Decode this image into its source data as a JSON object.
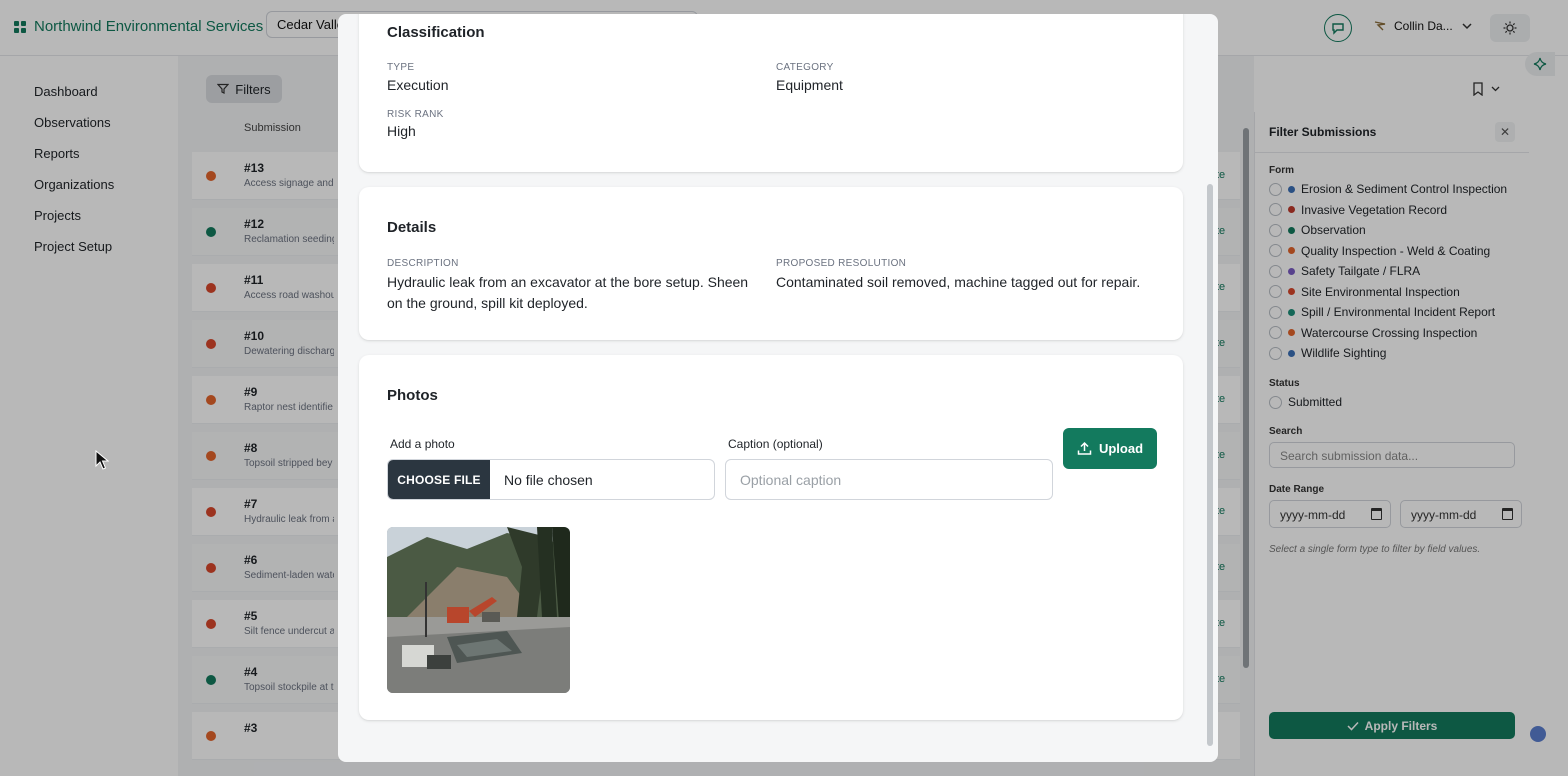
{
  "app": {
    "brand": "Northwind Environmental Services",
    "project_select": "Cedar Valle",
    "user_name": "Collin Da..."
  },
  "sidebar": {
    "items": [
      {
        "label": "Dashboard"
      },
      {
        "label": "Observations"
      },
      {
        "label": "Reports"
      },
      {
        "label": "Organizations"
      },
      {
        "label": "Projects"
      },
      {
        "label": "Project Setup"
      }
    ]
  },
  "list": {
    "filters_label": "Filters",
    "column_header": "Submission",
    "rows": [
      {
        "num": "#13",
        "desc": "Access signage and c",
        "color": "#e4642b",
        "trail": "te"
      },
      {
        "num": "#12",
        "desc": "Reclamation seeding",
        "color": "#137a5e",
        "trail": "te"
      },
      {
        "num": "#11",
        "desc": "Access road washout",
        "color": "#d9472b",
        "trail": "te"
      },
      {
        "num": "#10",
        "desc": "Dewatering discharg",
        "color": "#d9472b",
        "trail": "te"
      },
      {
        "num": "#9",
        "desc": "Raptor nest identifie",
        "color": "#e4642b",
        "trail": "te"
      },
      {
        "num": "#8",
        "desc": "Topsoil stripped bey",
        "color": "#e4642b",
        "trail": "te"
      },
      {
        "num": "#7",
        "desc": "Hydraulic leak from a",
        "color": "#d9472b",
        "trail": "te"
      },
      {
        "num": "#6",
        "desc": "Sediment-laden wate",
        "color": "#d9472b",
        "trail": "te"
      },
      {
        "num": "#5",
        "desc": "Silt fence undercut a",
        "color": "#d9472b",
        "trail": "te"
      },
      {
        "num": "#4",
        "desc": "Topsoil stockpile at t",
        "color": "#137a5e",
        "trail": "te"
      },
      {
        "num": "#3",
        "desc": "",
        "color": "#e4642b",
        "trail": ""
      }
    ]
  },
  "filter_panel": {
    "title": "Filter Submissions",
    "form_label": "Form",
    "forms": [
      {
        "label": "Erosion & Sediment Control Inspection",
        "color": "#3b6fb6"
      },
      {
        "label": "Invasive Vegetation Record",
        "color": "#c0392b"
      },
      {
        "label": "Observation",
        "color": "#137a5e"
      },
      {
        "label": "Quality Inspection - Weld & Coating",
        "color": "#e4642b"
      },
      {
        "label": "Safety Tailgate / FLRA",
        "color": "#7b5cc4"
      },
      {
        "label": "Site Environmental Inspection",
        "color": "#d9472b"
      },
      {
        "label": "Spill / Environmental Incident Report",
        "color": "#1c8f79"
      },
      {
        "label": "Watercourse Crossing Inspection",
        "color": "#e4642b"
      },
      {
        "label": "Wildlife Sighting",
        "color": "#3b6fb6"
      }
    ],
    "status_label": "Status",
    "status_option": "Submitted",
    "search_label": "Search",
    "search_placeholder": "Search submission data...",
    "date_label": "Date Range",
    "date_from": "yyyy-mm-dd",
    "date_to": "yyyy-mm-dd",
    "hint": "Select a single form type to filter by field values.",
    "apply_label": "Apply Filters"
  },
  "modal": {
    "classification": {
      "title": "Classification",
      "type_label": "TYPE",
      "type_value": "Execution",
      "category_label": "CATEGORY",
      "category_value": "Equipment",
      "risk_label": "RISK RANK",
      "risk_value": "High"
    },
    "details": {
      "title": "Details",
      "description_label": "DESCRIPTION",
      "description_value": "Hydraulic leak from an excavator at the bore setup. Sheen on the ground, spill kit deployed.",
      "resolution_label": "PROPOSED RESOLUTION",
      "resolution_value": "Contaminated soil removed, machine tagged out for repair."
    },
    "photos": {
      "title": "Photos",
      "add_photo_label": "Add a photo",
      "choose_file_label": "CHOOSE FILE",
      "no_file_text": "No file chosen",
      "caption_label": "Caption (optional)",
      "caption_placeholder": "Optional caption",
      "upload_label": "Upload"
    }
  },
  "colors": {
    "accent": "#137a5e",
    "dark_button": "#2b3640"
  }
}
